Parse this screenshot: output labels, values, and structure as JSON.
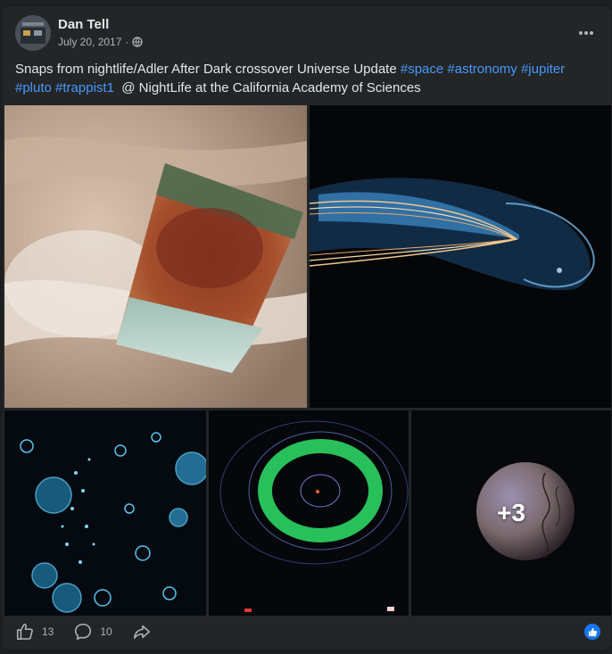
{
  "post": {
    "author": "Dan Tell",
    "date": "July 20, 2017",
    "separator": "·",
    "text_prefix": "Snaps from nightlife/Adler After Dark crossover Universe Update ",
    "hashtags": [
      "#space",
      "#astronomy",
      "#jupiter",
      "#pluto",
      "#trappist1"
    ],
    "location_text": "@ NightLife at the California Academy of Sciences"
  },
  "gallery": {
    "photos": [
      {
        "alt": "Jupiter Great Red Spot"
      },
      {
        "alt": "Blue magnetosphere visualization"
      },
      {
        "alt": "Blue bubbles field"
      },
      {
        "alt": "Green ring orbit diagram"
      },
      {
        "alt": "Planet sphere"
      }
    ],
    "more_count": "+3"
  },
  "footer": {
    "likes": "13",
    "comments": "10"
  },
  "colors": {
    "card": "#242526",
    "hashtag": "#4599ff",
    "reaction": "#1877f2"
  },
  "icons": {
    "privacy": "globe-icon",
    "more": "more-options-icon",
    "like": "thumbs-up-icon",
    "comment": "comment-icon",
    "share": "share-icon",
    "reaction": "like-reaction-icon"
  }
}
